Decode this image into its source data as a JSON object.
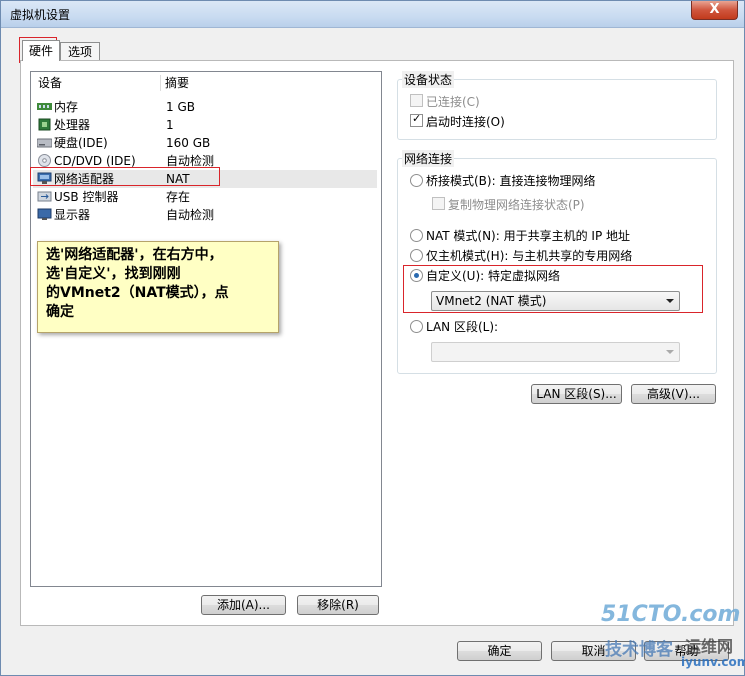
{
  "window": {
    "title": "虚拟机设置",
    "close_glyph": "X"
  },
  "tabs": [
    {
      "label": "硬件"
    },
    {
      "label": "选项"
    }
  ],
  "device_list": {
    "columns": {
      "device": "设备",
      "summary": "摘要"
    },
    "rows": [
      {
        "name": "内存",
        "value": "1 GB",
        "icon": "memory-icon"
      },
      {
        "name": "处理器",
        "value": "1",
        "icon": "processor-icon"
      },
      {
        "name": "硬盘(IDE)",
        "value": "160 GB",
        "icon": "hard-disk-icon"
      },
      {
        "name": "CD/DVD (IDE)",
        "value": "自动检测",
        "icon": "cd-dvd-icon"
      },
      {
        "name": "网络适配器",
        "value": "NAT",
        "icon": "network-adapter-icon",
        "selected": true
      },
      {
        "name": "USB 控制器",
        "value": "存在",
        "icon": "usb-icon"
      },
      {
        "name": "显示器",
        "value": "自动检测",
        "icon": "display-icon"
      }
    ],
    "add_button": "添加(A)...",
    "remove_button": "移除(R)"
  },
  "annotation_note": "选'网络适配器'，在右方中，\n选'自定义'，找到刚刚\n的VMnet2（NAT模式），点\n确定",
  "device_status": {
    "label": "设备状态",
    "connected": {
      "label": "已连接(C)",
      "checked": false,
      "disabled": true
    },
    "connect_at_power_on": {
      "label": "启动时连接(O)",
      "checked": true
    }
  },
  "network_connection": {
    "label": "网络连接",
    "bridged": {
      "label": "桥接模式(B): 直接连接物理网络",
      "selected": false
    },
    "replicate": {
      "label": "复制物理网络连接状态(P)",
      "disabled": true
    },
    "nat": {
      "label": "NAT 模式(N): 用于共享主机的 IP 地址",
      "selected": false
    },
    "host_only": {
      "label": "仅主机模式(H): 与主机共享的专用网络",
      "selected": false
    },
    "custom": {
      "label": "自定义(U): 特定虚拟网络",
      "selected": true
    },
    "custom_select_value": "VMnet2 (NAT 模式)",
    "lan_segment": {
      "label": "LAN 区段(L):",
      "selected": false
    },
    "lan_segment_select_value": ""
  },
  "buttons": {
    "lan_segments": "LAN 区段(S)...",
    "advanced": "高级(V)...",
    "ok": "确定",
    "cancel": "取消",
    "help": "帮助"
  },
  "watermarks": {
    "site": "51CTO.com",
    "blog": "技术博客",
    "yunwei": "运维网",
    "domain": "iyunv.com"
  },
  "colors": {
    "highlight_red": "#d9252b",
    "note_background": "#ffffc4"
  }
}
